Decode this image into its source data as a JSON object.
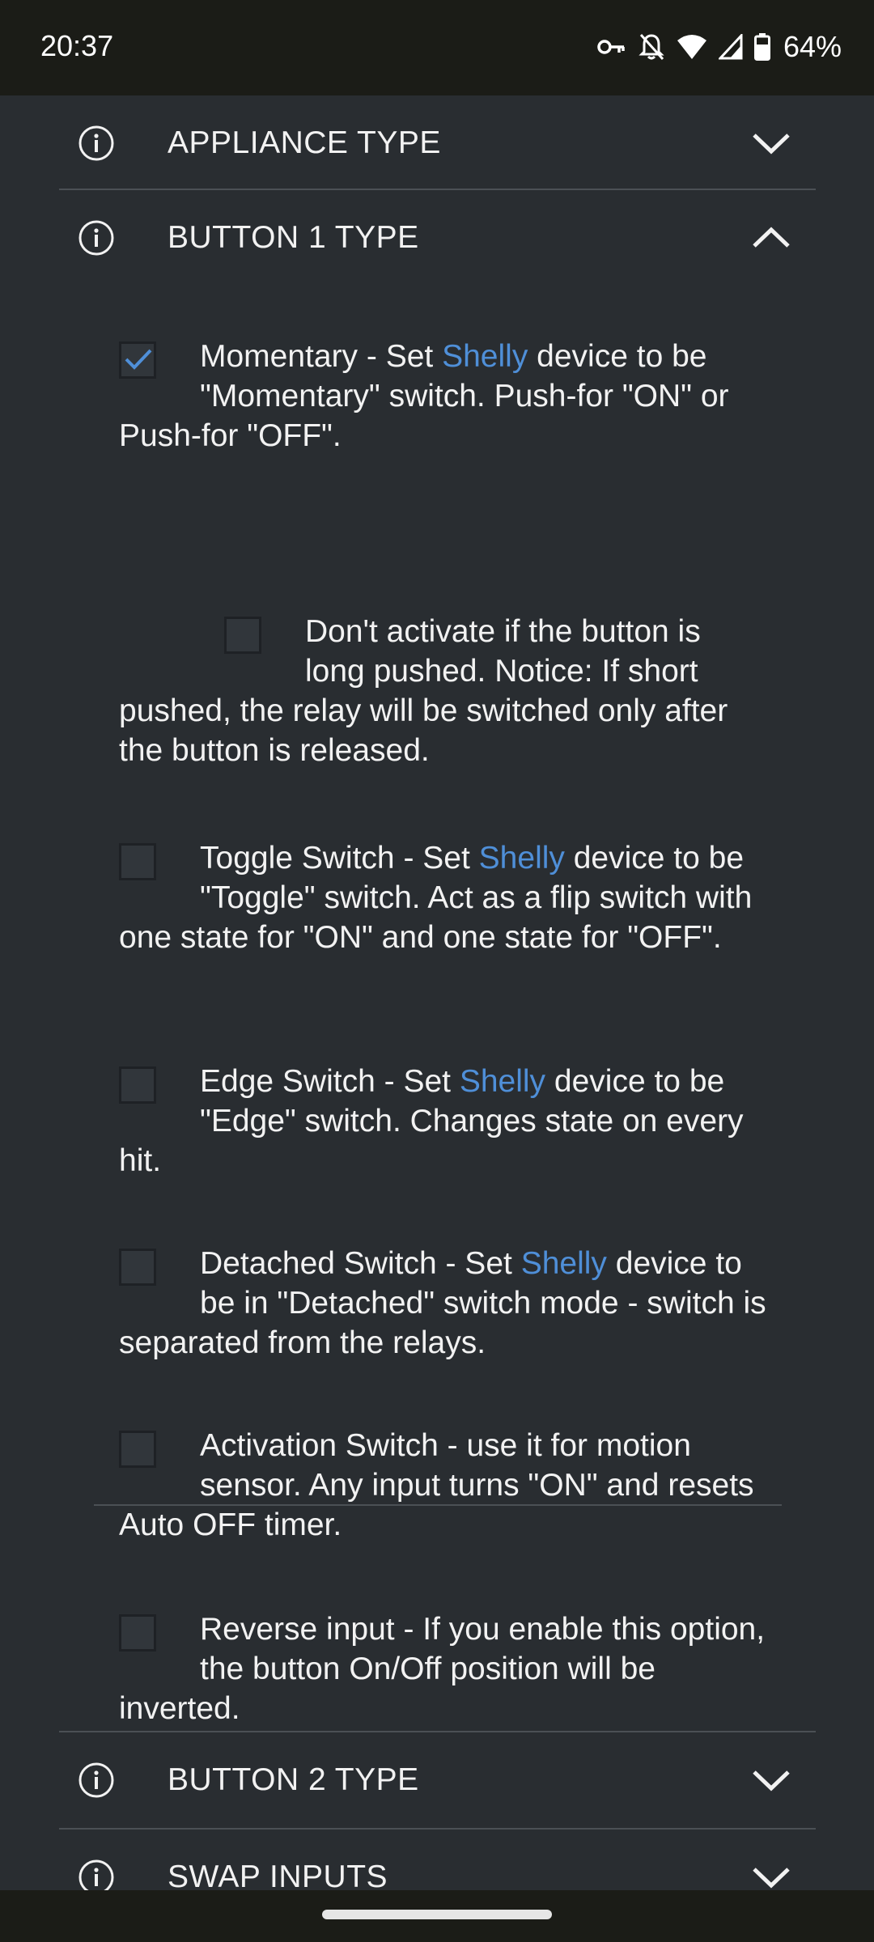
{
  "status_bar": {
    "time": "20:37",
    "battery": "64%",
    "icons": [
      "vpn-key-icon",
      "notifications-off-icon",
      "wifi-icon",
      "signal-icon",
      "battery-icon"
    ]
  },
  "sections": {
    "appliance_type": "APPLIANCE TYPE",
    "button1_type": "BUTTON 1 TYPE",
    "button2_type": "BUTTON 2 TYPE",
    "swap_inputs": "SWAP INPUTS"
  },
  "options": {
    "momentary": {
      "checked": true,
      "before": "Momentary - Set ",
      "link": "Shelly",
      "after": " device to be \"Momentary\" switch. Push-for \"ON\" or Push-for \"OFF\"."
    },
    "long_push": {
      "checked": false,
      "text": "Don't activate if the button is long pushed. Notice: If short pushed, the relay will be switched only after the button is released."
    },
    "toggle": {
      "checked": false,
      "before": "Toggle Switch - Set ",
      "link": "Shelly",
      "after": " device to be \"Toggle\" switch. Act as a flip switch with one state for \"ON\" and one state for \"OFF\"."
    },
    "edge": {
      "checked": false,
      "before": "Edge Switch - Set ",
      "link": "Shelly",
      "after": " device to be \"Edge\" switch. Changes state on every hit."
    },
    "detached": {
      "checked": false,
      "before": "Detached Switch - Set ",
      "link": "Shelly",
      "after": " device to be in \"Detached\" switch mode - switch is separated from the relays."
    },
    "activation": {
      "checked": false,
      "text": "Activation Switch - use it for motion sensor. Any input turns \"ON\" and resets Auto OFF timer."
    },
    "reverse": {
      "checked": false,
      "text": "Reverse input - If you enable this option, the button On/Off position will be inverted."
    }
  },
  "colors": {
    "background": "#292d31",
    "status_bar": "#1b1c17",
    "link": "#4f8fd8",
    "check": "#4f8fd8"
  }
}
